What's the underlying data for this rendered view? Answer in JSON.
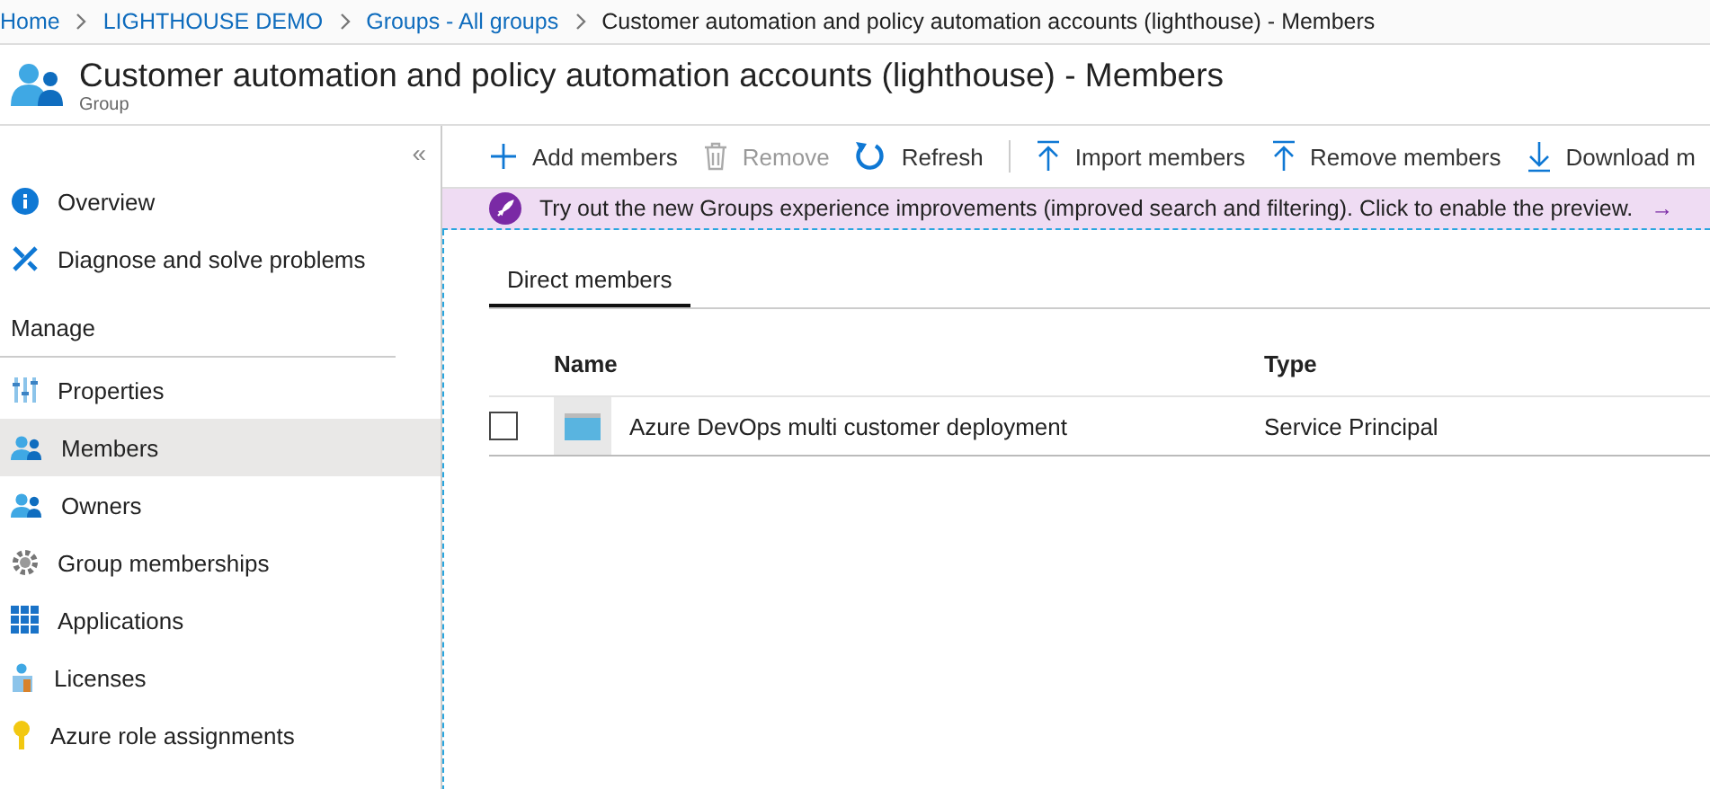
{
  "breadcrumb": [
    {
      "label": "Home",
      "link": true
    },
    {
      "label": "LIGHTHOUSE DEMO",
      "link": true
    },
    {
      "label": "Groups - All groups",
      "link": true
    },
    {
      "label": "Customer automation and policy automation accounts (lighthouse) - Members",
      "link": false
    }
  ],
  "header": {
    "title": "Customer automation and policy automation accounts (lighthouse) - Members",
    "subtitle": "Group"
  },
  "sidebar": {
    "collapse": "«",
    "items": [
      {
        "label": "Overview",
        "selected": false
      },
      {
        "label": "Diagnose and solve problems",
        "selected": false
      }
    ],
    "section": "Manage",
    "section_items": [
      {
        "label": "Properties",
        "selected": false
      },
      {
        "label": "Members",
        "selected": true
      },
      {
        "label": "Owners",
        "selected": false
      },
      {
        "label": "Group memberships",
        "selected": false
      },
      {
        "label": "Applications",
        "selected": false
      },
      {
        "label": "Licenses",
        "selected": false
      },
      {
        "label": "Azure role assignments",
        "selected": false
      }
    ]
  },
  "toolbar": [
    {
      "label": "Add members",
      "disabled": false
    },
    {
      "label": "Remove",
      "disabled": true
    },
    {
      "label": "Refresh",
      "disabled": false
    },
    {
      "label": "Import members",
      "disabled": false
    },
    {
      "label": "Remove members",
      "disabled": false
    },
    {
      "label": "Download m",
      "disabled": false
    }
  ],
  "banner": {
    "text": "Try out the new Groups experience improvements (improved search and filtering). Click to enable the preview.",
    "arrow": "→"
  },
  "tabs": [
    {
      "label": "Direct members",
      "selected": true
    }
  ],
  "table": {
    "columns": [
      "Name",
      "Type"
    ],
    "rows": [
      {
        "name": "Azure DevOps multi customer deployment",
        "type": "Service Principal",
        "checked": false
      }
    ]
  }
}
